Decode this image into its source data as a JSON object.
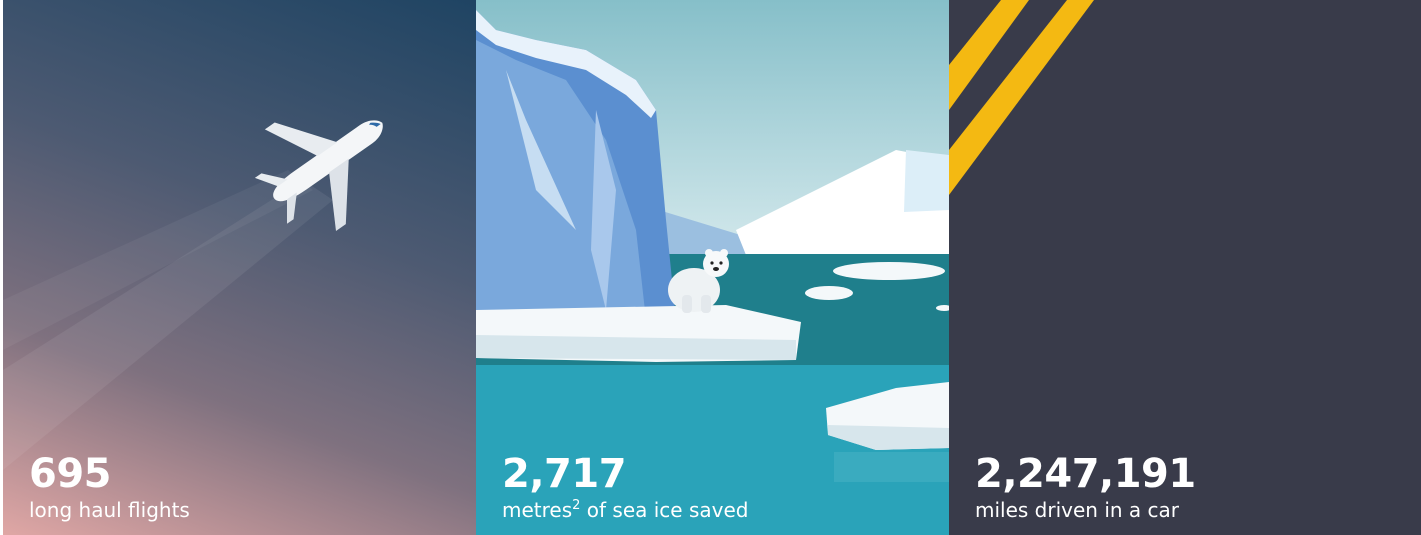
{
  "panels": {
    "flights": {
      "value": "695",
      "label": "long haul flights",
      "icon": "airplane-icon"
    },
    "ice": {
      "value": "2,717",
      "label_prefix": "metres",
      "label_sup": "2",
      "label_suffix": " of sea ice saved",
      "icon": "polar-bear-icon"
    },
    "car": {
      "value": "2,247,191",
      "label": "miles driven in a car",
      "icon": "road-stripes-icon"
    }
  },
  "colors": {
    "flights_dark": "#1f4463",
    "flights_pink": "#e0a7a5",
    "ice_water": "#1f7f8c",
    "ice_blue": "#5b8fd0",
    "car_bg": "#393b4a",
    "stripe_yellow": "#f4b912",
    "text": "#ffffff"
  }
}
